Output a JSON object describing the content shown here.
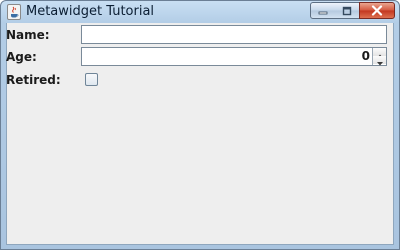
{
  "window": {
    "title": "Metawidget Tutorial",
    "app_icon": "java-cup-icon",
    "controls": [
      "minimize-icon",
      "maximize-icon",
      "close-icon"
    ]
  },
  "form": {
    "name": {
      "label": "Name:",
      "value": ""
    },
    "age": {
      "label": "Age:",
      "value": "0"
    },
    "retired": {
      "label": "Retired:",
      "checked": false
    }
  }
}
